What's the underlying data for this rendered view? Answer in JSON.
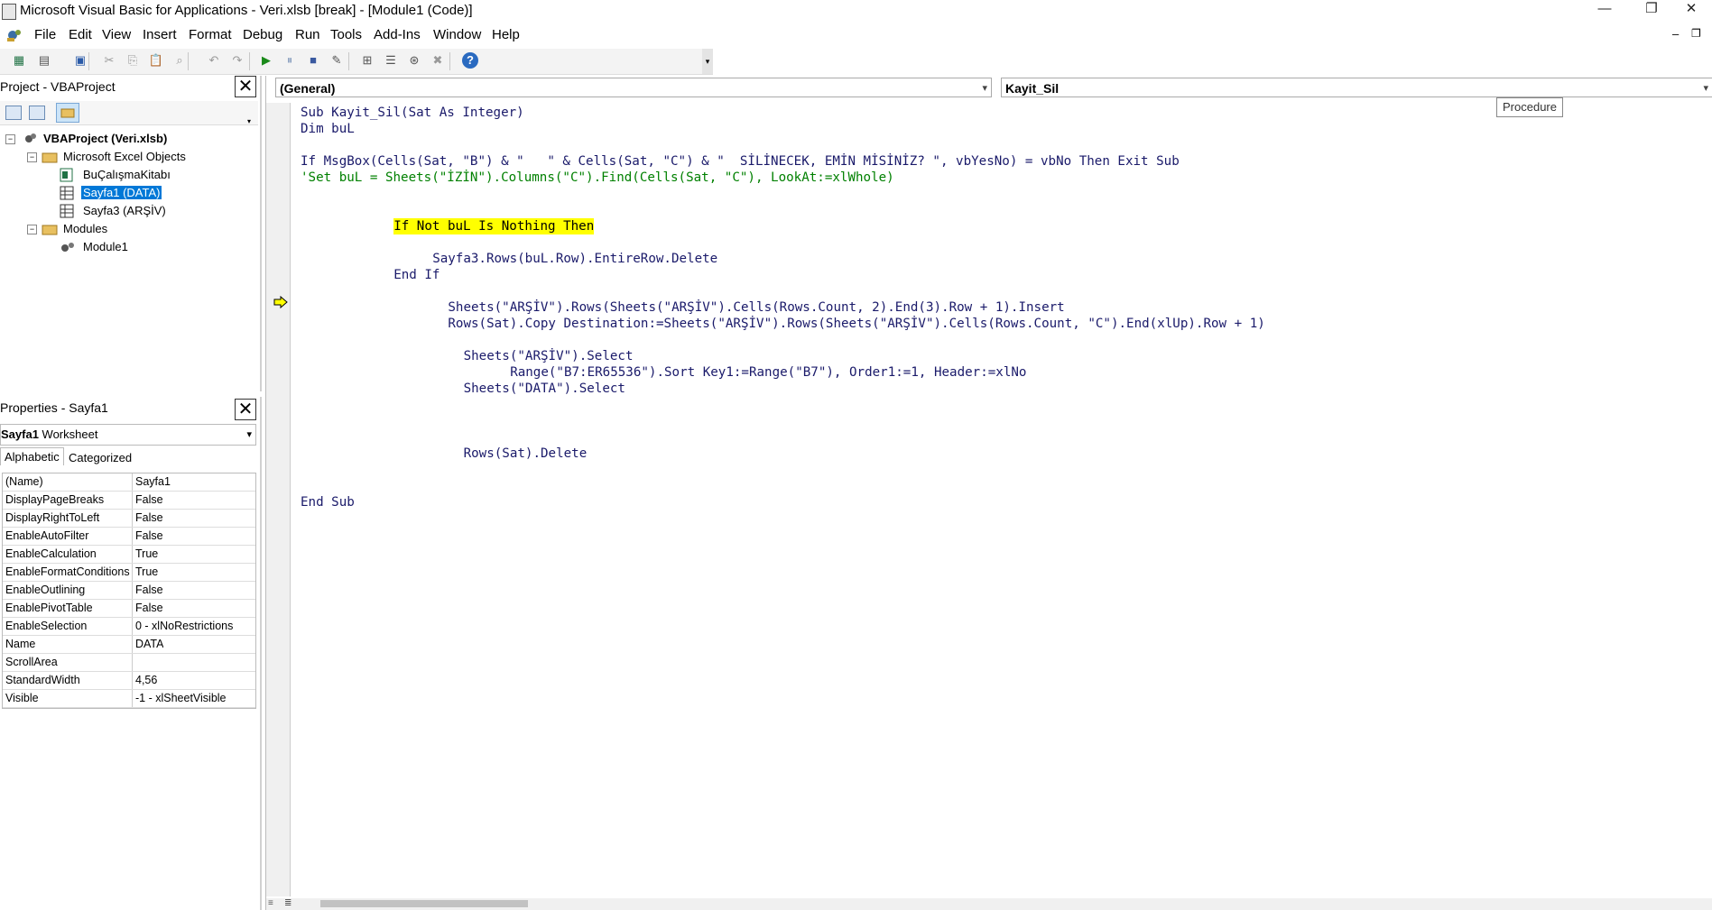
{
  "window": {
    "title": "Microsoft Visual Basic for Applications - Veri.xlsb [break] - [Module1 (Code)]",
    "minimize": "—",
    "maximize": "❐",
    "close": "✕"
  },
  "menu": {
    "items": [
      "File",
      "Edit",
      "View",
      "Insert",
      "Format",
      "Debug",
      "Run",
      "Tools",
      "Add-Ins",
      "Window",
      "Help"
    ],
    "inner_min": "–",
    "inner_restore": "❐"
  },
  "toolbar": {
    "icons": [
      "excel-view-icon",
      "insert-module-icon",
      "save-icon",
      "cut-icon",
      "copy-icon",
      "paste-icon",
      "find-icon",
      "undo-icon",
      "redo-icon",
      "run-icon",
      "break-icon",
      "reset-icon",
      "design-mode-icon",
      "project-explorer-icon",
      "properties-icon",
      "object-browser-icon",
      "toolbox-icon",
      "help-icon"
    ]
  },
  "project": {
    "title": "Project - VBAProject",
    "root": "VBAProject (Veri.xlsb)",
    "folder_objects": "Microsoft Excel Objects",
    "items": [
      "BuÇalışmaKitabı",
      "Sayfa1 (DATA)",
      "Sayfa3 (ARŞİV)"
    ],
    "folder_modules": "Modules",
    "modules": [
      "Module1"
    ]
  },
  "properties": {
    "title": "Properties - Sayfa1",
    "object_name": "Sayfa1",
    "object_type": "Worksheet",
    "tabs": [
      "Alphabetic",
      "Categorized"
    ],
    "rows": [
      {
        "name": "(Name)",
        "value": "Sayfa1"
      },
      {
        "name": "DisplayPageBreaks",
        "value": "False"
      },
      {
        "name": "DisplayRightToLeft",
        "value": "False"
      },
      {
        "name": "EnableAutoFilter",
        "value": "False"
      },
      {
        "name": "EnableCalculation",
        "value": "True"
      },
      {
        "name": "EnableFormatConditions",
        "value": "True"
      },
      {
        "name": "EnableOutlining",
        "value": "False"
      },
      {
        "name": "EnablePivotTable",
        "value": "False"
      },
      {
        "name": "EnableSelection",
        "value": "0 - xlNoRestrictions"
      },
      {
        "name": "Name",
        "value": "DATA"
      },
      {
        "name": "ScrollArea",
        "value": ""
      },
      {
        "name": "StandardWidth",
        "value": "4,56"
      },
      {
        "name": "Visible",
        "value": "-1 - xlSheetVisible"
      }
    ]
  },
  "code": {
    "object_combo": "(General)",
    "proc_combo": "Kayit_Sil",
    "tooltip": "Procedure",
    "lines": [
      {
        "text": "Sub Kayit_Sil(Sat As Integer)",
        "style": "normal",
        "indent": 0
      },
      {
        "text": "Dim buL",
        "style": "normal",
        "indent": 0
      },
      {
        "text": "",
        "style": "normal",
        "indent": 0
      },
      {
        "text": "If MsgBox(Cells(Sat, \"B\") & \"   \" & Cells(Sat, \"C\") & \"  SİLİNECEK, EMİN MİSİNİZ? \", vbYesNo) = vbNo Then Exit Sub",
        "style": "normal",
        "indent": 0
      },
      {
        "text": "'Set buL = Sheets(\"İZİN\").Columns(\"C\").Find(Cells(Sat, \"C\"), LookAt:=xlWhole)",
        "style": "comment",
        "indent": 0
      },
      {
        "text": "",
        "style": "normal",
        "indent": 0
      },
      {
        "text": "",
        "style": "normal",
        "indent": 0
      },
      {
        "text": "If Not buL Is Nothing Then",
        "style": "highlight",
        "indent": 12
      },
      {
        "text": "",
        "style": "normal",
        "indent": 0
      },
      {
        "text": "Sayfa3.Rows(buL.Row).EntireRow.Delete",
        "style": "normal",
        "indent": 17
      },
      {
        "text": "End If",
        "style": "normal",
        "indent": 12
      },
      {
        "text": "",
        "style": "normal",
        "indent": 0
      },
      {
        "text": "Sheets(\"ARŞİV\").Rows(Sheets(\"ARŞİV\").Cells(Rows.Count, 2).End(3).Row + 1).Insert",
        "style": "normal",
        "indent": 19
      },
      {
        "text": "Rows(Sat).Copy Destination:=Sheets(\"ARŞİV\").Rows(Sheets(\"ARŞİV\").Cells(Rows.Count, \"C\").End(xlUp).Row + 1)",
        "style": "normal",
        "indent": 19
      },
      {
        "text": "",
        "style": "normal",
        "indent": 0
      },
      {
        "text": "Sheets(\"ARŞİV\").Select",
        "style": "normal",
        "indent": 21
      },
      {
        "text": "Range(\"B7:ER65536\").Sort Key1:=Range(\"B7\"), Order1:=1, Header:=xlNo",
        "style": "normal",
        "indent": 27
      },
      {
        "text": "Sheets(\"DATA\").Select",
        "style": "normal",
        "indent": 21
      },
      {
        "text": "",
        "style": "normal",
        "indent": 0
      },
      {
        "text": "",
        "style": "normal",
        "indent": 0
      },
      {
        "text": "",
        "style": "normal",
        "indent": 0
      },
      {
        "text": "Rows(Sat).Delete",
        "style": "normal",
        "indent": 21
      },
      {
        "text": "",
        "style": "normal",
        "indent": 0
      },
      {
        "text": "",
        "style": "normal",
        "indent": 0
      },
      {
        "text": "End Sub",
        "style": "normal",
        "indent": 0
      }
    ]
  }
}
